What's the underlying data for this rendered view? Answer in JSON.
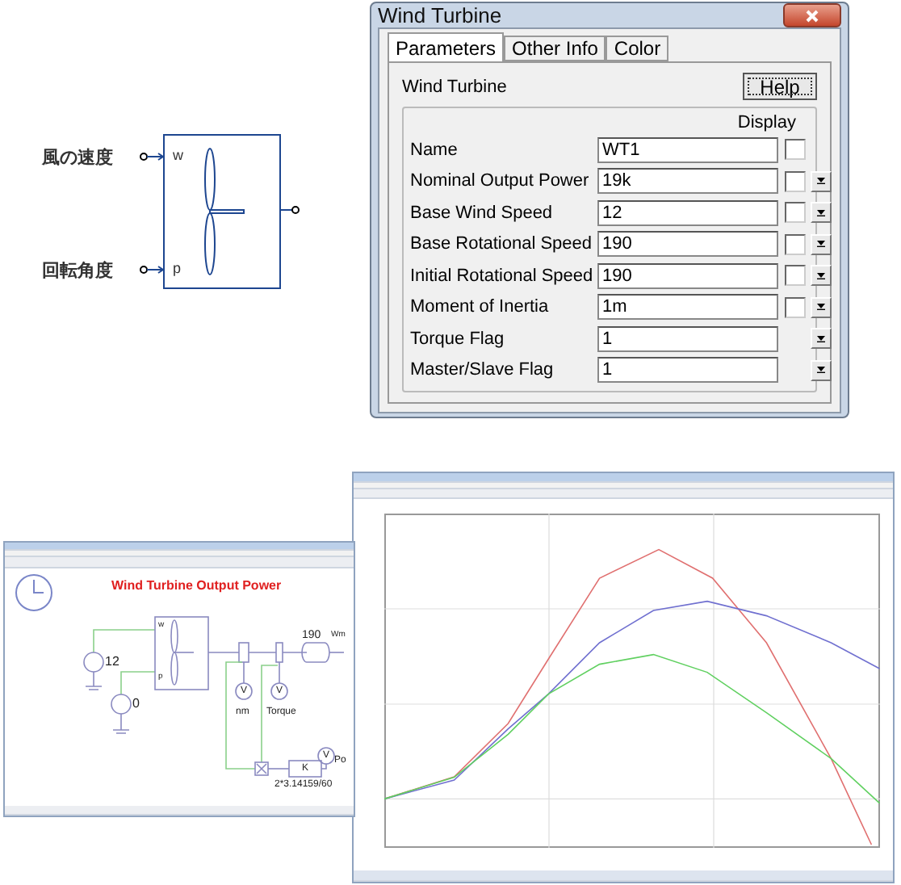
{
  "block": {
    "inputs": [
      {
        "label": "風の速度",
        "pin": "w"
      },
      {
        "label": "回転角度",
        "pin": "p"
      }
    ]
  },
  "dialog": {
    "title": "Wind Turbine",
    "tabs": [
      {
        "label": "Parameters",
        "selected": true
      },
      {
        "label": "Other Info",
        "selected": false
      },
      {
        "label": "Color",
        "selected": false
      }
    ],
    "heading": "Wind Turbine",
    "help": "Help",
    "display_header": "Display",
    "rows": [
      {
        "kind": "check",
        "label": "Name",
        "value": "WT1",
        "checked": false
      },
      {
        "kind": "both",
        "label": "Nominal Output Power",
        "value": "19k",
        "checked": false
      },
      {
        "kind": "both",
        "label": "Base Wind Speed",
        "value": "12",
        "checked": false
      },
      {
        "kind": "both",
        "label": "Base Rotational Speed",
        "value": "190",
        "checked": false
      },
      {
        "kind": "both",
        "label": "Initial Rotational Speed",
        "value": "190",
        "checked": false
      },
      {
        "kind": "both",
        "label": "Moment of Inertia",
        "value": "1m",
        "checked": false
      },
      {
        "kind": "list",
        "label": "Torque Flag",
        "value": "1"
      },
      {
        "kind": "list",
        "label": "Master/Slave Flag",
        "value": "1"
      }
    ]
  },
  "schematic": {
    "title": "Wind Turbine Output Power",
    "wind_source": "12",
    "angle_source": "0",
    "pin_w": "w",
    "pin_p": "p",
    "speed": "190",
    "speed_label": "Wm",
    "meters": [
      {
        "symbol": "V",
        "label": "nm"
      },
      {
        "symbol": "V",
        "label": "Torque"
      },
      {
        "symbol": "V",
        "label": "Po"
      }
    ],
    "gain": "K",
    "gain_value": "2*3.14159/60"
  }
}
